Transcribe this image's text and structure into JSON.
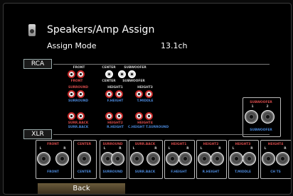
{
  "header": {
    "title": "Speakers/Amp Assign",
    "mode_label": "Assign Mode",
    "mode_value": "13.1ch",
    "icon": "speaker-icon"
  },
  "sections": {
    "rca": "RCA",
    "xlr": "XLR"
  },
  "rca_groups": [
    {
      "top": "FRONT",
      "bottom": "FRONT"
    },
    {
      "top": "CENTER",
      "bottom": "CENTER"
    },
    {
      "top": "SUBWOOFER",
      "bottom": "SUBWOOFER"
    },
    {
      "top": "SURROUND",
      "bottom": "SURROUND"
    },
    {
      "top": "HEIGHT1",
      "bottom": "F.HEIGHT"
    },
    {
      "top": "HEIGHT3",
      "bottom": "T.MIDDLE"
    },
    {
      "top": "SURR.BACK",
      "bottom": "SURR.BACK"
    },
    {
      "top": "HEIGHT2",
      "bottom": "R.HEIGHT"
    },
    {
      "top": "HEIGHT4",
      "bottom": "C.HEIGHT T.SURROUND"
    }
  ],
  "xlr_subwoofer": {
    "top": "SUBWOOFER",
    "bottom": "SUBWOOFER",
    "l": "1",
    "r": "2"
  },
  "xlr_groups": [
    {
      "top": "FRONT",
      "bottom": "FRONT"
    },
    {
      "top": "CENTER",
      "bottom": "CENTER"
    },
    {
      "top": "SURROUND",
      "bottom": "SURROUND"
    },
    {
      "top": "SURR.BACK",
      "bottom": "SURR.BACK"
    },
    {
      "top": "HEIGHT1",
      "bottom": "F.HEIGHT"
    },
    {
      "top": "HEIGHT2",
      "bottom": "R.HEIGHT"
    },
    {
      "top": "HEIGHT3",
      "bottom": "T.MIDDLE"
    },
    {
      "top": "HEIGHT4",
      "bottom": "CH TS"
    }
  ],
  "channel_marks": {
    "l": "L",
    "r": "R"
  },
  "back_button": "Back"
}
